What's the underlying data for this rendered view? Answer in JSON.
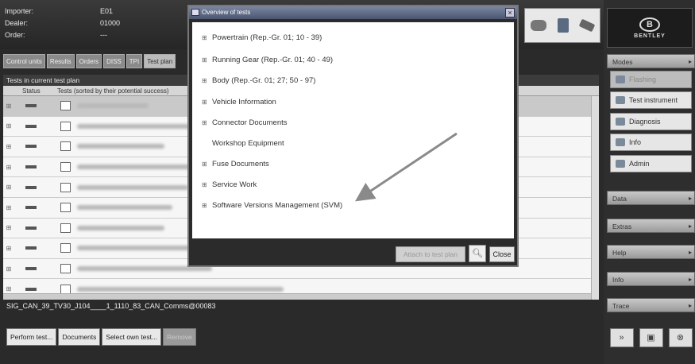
{
  "header": {
    "importer_label": "Importer:",
    "importer_value": "E01",
    "dealer_label": "Dealer:",
    "dealer_value": "01000",
    "order_label": "Order:",
    "order_value": "---"
  },
  "tabs": [
    "Control units",
    "Results",
    "Orders",
    "DISS",
    "TPI",
    "Test plan"
  ],
  "test_plan": {
    "title": "Tests in current test plan",
    "col_status": "Status",
    "col_tests": "Tests (sorted by their potential success)",
    "rows": 10
  },
  "status_line": "SIG_CAN_39_TV30_J104____1_1110_83_CAN_Comms@00083",
  "bottom_buttons": {
    "perform": "Perform test...",
    "documents": "Documents",
    "select_own": "Select own test...",
    "remove": "Remove"
  },
  "sidebar": {
    "logo": "BENTLEY",
    "modes_label": "Modes",
    "mode_items": [
      "Flashing",
      "Test instrument",
      "Diagnosis",
      "Info",
      "Admin"
    ],
    "sections": [
      "Data",
      "Extras",
      "Help",
      "Info",
      "Trace"
    ]
  },
  "dialog": {
    "title": "Overview of tests",
    "items": [
      {
        "label": "Powertrain (Rep.-Gr. 01; 10 - 39)",
        "expandable": true
      },
      {
        "label": "Running Gear (Rep.-Gr. 01; 40 - 49)",
        "expandable": true
      },
      {
        "label": "Body (Rep.-Gr. 01; 27; 50 - 97)",
        "expandable": true
      },
      {
        "label": "Vehicle Information",
        "expandable": true
      },
      {
        "label": "Connector Documents",
        "expandable": true
      },
      {
        "label": "Workshop Equipment",
        "expandable": false
      },
      {
        "label": "Fuse Documents",
        "expandable": true
      },
      {
        "label": "Service Work",
        "expandable": true
      },
      {
        "label": "Software Versions Management (SVM)",
        "expandable": true
      }
    ],
    "attach_button": "Attach to test plan",
    "close_button": "Close"
  },
  "colors": {
    "dialog_title_bar": "#4a5570",
    "background": "#2a2a2a",
    "arrow": "#888888"
  }
}
